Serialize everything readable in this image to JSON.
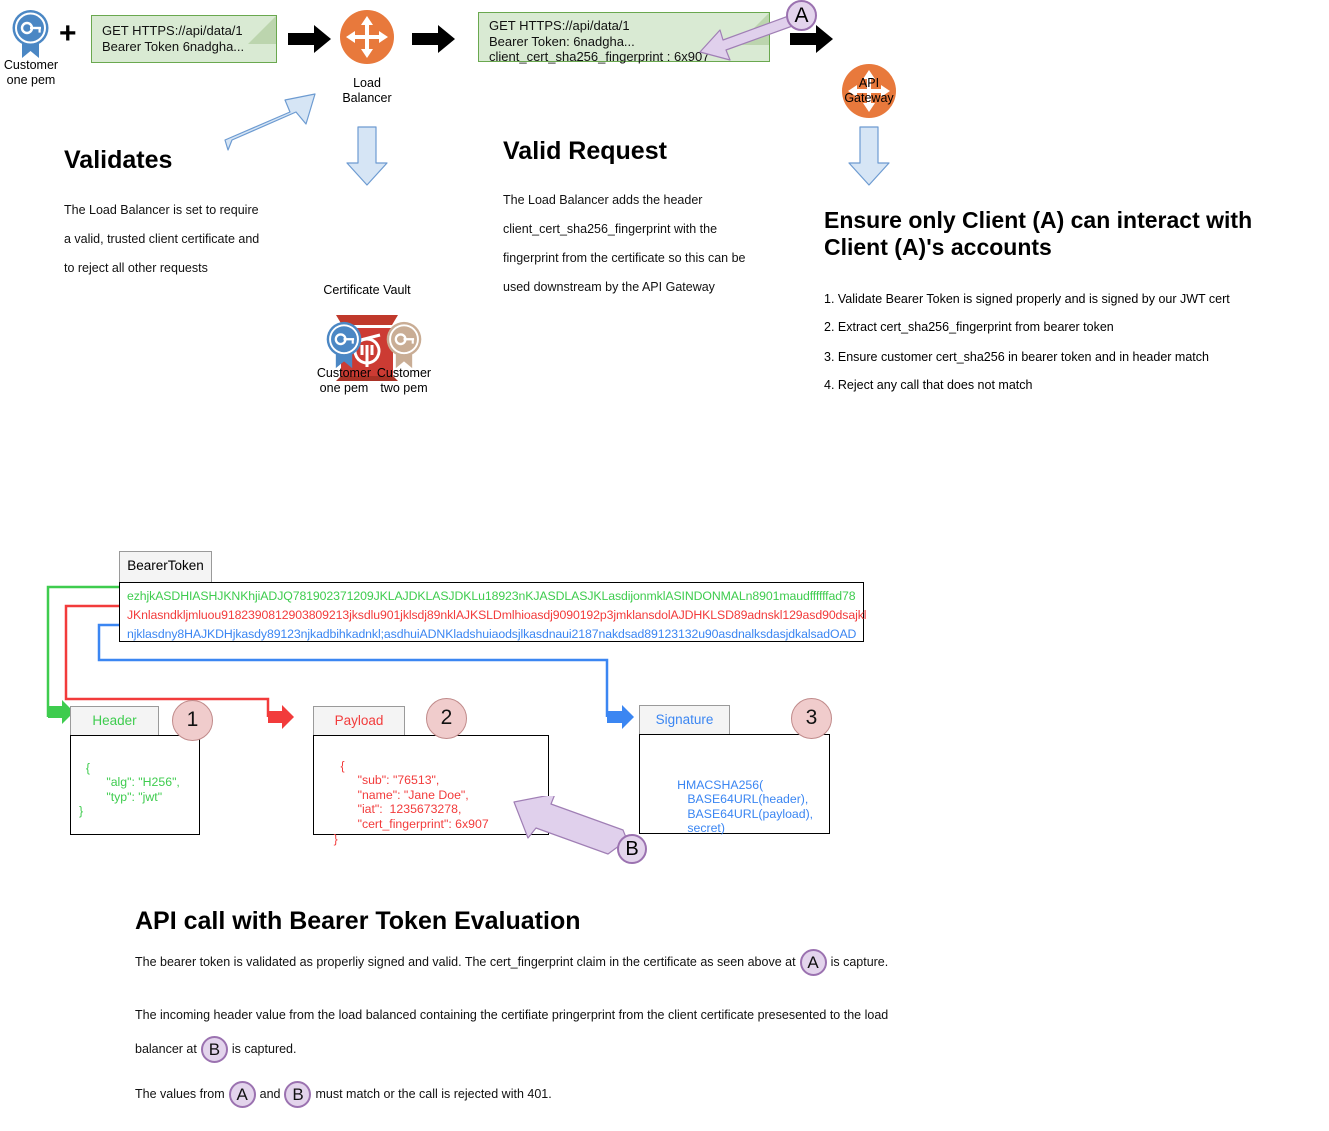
{
  "top_flow": {
    "client_cert": {
      "label_line1": "Customer",
      "label_line2": "one pem",
      "icon": "certificate-ribbon-icon",
      "color": "#4b87c4"
    },
    "plus": "+",
    "request_1": {
      "lines": [
        "GET HTTPS://api/data/1",
        "Bearer Token 6nadgha..."
      ],
      "fill": "#d9ead3",
      "stroke": "#6aa84f"
    },
    "arrow_1": "right-arrow-icon",
    "load_balancer": {
      "label_line1": "Load",
      "label_line2": "Balancer",
      "icon": "router-icon",
      "color": "#e8793c"
    },
    "arrow_2": "right-arrow-icon",
    "request_2": {
      "lines": [
        "GET HTTPS://api/data/1",
        "Bearer Token: 6nadgha...",
        "client_cert_sha256_fingerprint : 6x907"
      ],
      "fill": "#d9ead3",
      "stroke": "#6aa84f"
    },
    "callout_a": "A",
    "arrow_3": "right-arrow-icon",
    "api_gateway": {
      "label_line1": "API",
      "label_line2": "Gateway",
      "icon": "router-icon",
      "color": "#e8793c"
    }
  },
  "validates": {
    "heading": "Validates",
    "lines": [
      "The Load Balancer is set to require",
      "a valid, trusted client certificate and",
      "to reject all other requests"
    ]
  },
  "valid_request": {
    "heading": "Valid Request",
    "lines": [
      "The Load Balancer adds the header",
      "client_cert_sha256_fingerprint with the",
      "fingerprint from the certificate so this can be",
      "used downstream by the API Gateway"
    ]
  },
  "ensure": {
    "heading_line1": "Ensure only Client (A) can interact with",
    "heading_line2": "Client (A)'s accounts",
    "steps": [
      "1. Validate Bearer Token is signed properly and is signed by our JWT cert",
      "2. Extract cert_sha256_fingerprint from bearer token",
      "3. Ensure customer cert_sha256 in bearer token and in header match",
      "4. Reject any call that does not match"
    ]
  },
  "vault": {
    "label": "Certificate Vault",
    "icon": "vault-icon",
    "color": "#cc3b33",
    "certs": [
      {
        "line1": "Customer",
        "line2": "one pem",
        "icon": "certificate-ribbon-icon",
        "color": "#4b87c4"
      },
      {
        "line1": "Customer",
        "line2": "two pem",
        "icon": "certificate-ribbon-icon",
        "color": "#c9ad95"
      }
    ]
  },
  "jwt": {
    "tab_label": "BearerToken",
    "token_lines": [
      {
        "text": "ezhjkASDHIASHJKNKhjiADJQ781902371209JKLAJDKLASJDKLu18923nKJASDLASJKLasdijonmklASINDONMALn8901maudffffffad78",
        "color": "#3ecc4e"
      },
      {
        "text": "JKnlasndkljmluou9182390812903809213jksdlu901jklsdj89nklAJKSLDmlhioasdj9090192p3jmklansdolAJDHKLSD89adnskl129asd90dsajkl",
        "color": "#f23b3b"
      },
      {
        "text": "njklasdny8HAJKDHjkasdy89123njkadbihkadnkl;asdhuiADNKladshuiaodsjlkasdnaui2187nakdsad89123132u90asdnalksdasjdkalsadOAD",
        "color": "#3b86f2"
      }
    ],
    "parts": [
      {
        "tab": "Header",
        "color": "#3ecc4e",
        "number": "1",
        "body": "{\n        \"alg\": \"H256\",\n        \"typ\": \"jwt\"\n}"
      },
      {
        "tab": "Payload",
        "color": "#f23b3b",
        "number": "2",
        "body": "    {\n           \"sub\": \"76513\",\n           \"name\": \"Jane Doe\",\n           \"iat\":  1235673278,\n           \"cert_fingerprint\": 6x907\n    }"
      },
      {
        "tab": "Signature",
        "color": "#3b86f2",
        "number": "3",
        "body": "   HMACSHA256(\n        BASE64URL(header),\n        BASE64URL(payload),\n        secret)"
      }
    ],
    "callout_b": "B"
  },
  "bottom": {
    "heading": "API call with Bearer Token Evaluation",
    "para1_pre": "The bearer token is validated as properliy signed and valid.  The cert_fingerprint claim in the certificate as seen above at",
    "para1_badge": "A",
    "para1_post": "is capture.",
    "para2_line1": "The incoming header value from the load balanced containing the certifiate pringerprint from the client certificate presesented to the load",
    "para2_pre": "balancer at",
    "para2_badge": "B",
    "para2_post": "is captured.",
    "para3_pre": "The values from",
    "para3_badge_a": "A",
    "para3_mid": "and",
    "para3_badge_b": "B",
    "para3_post": "must match or the call is rejected with 401."
  }
}
